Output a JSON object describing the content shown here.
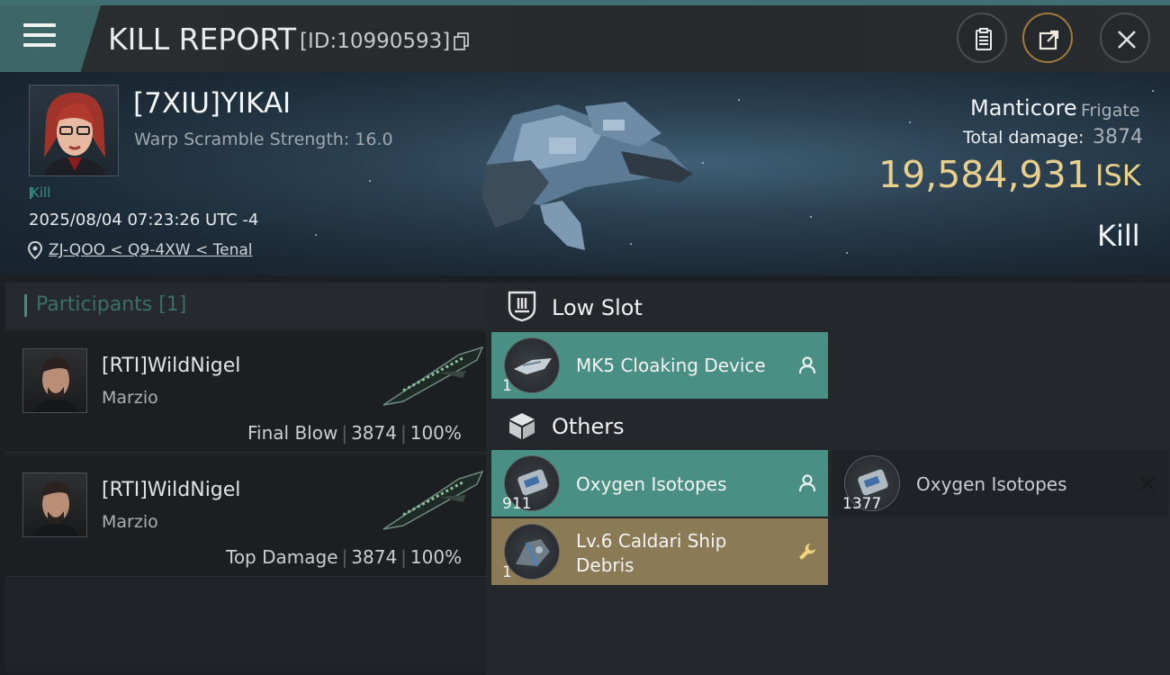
{
  "header": {
    "title": "KILL REPORT",
    "report_id": "[ID:10990593]"
  },
  "victim": {
    "name": "[7XIU]YIKAI",
    "warp_scramble": "Warp Scramble Strength: 16.0",
    "tag": "Kill",
    "timestamp": "2025/08/04 07:23:26 UTC -4",
    "location": "ZJ-QOO < Q9-4XW < Tenal"
  },
  "ship": {
    "name": "Manticore",
    "class": "Frigate",
    "total_damage_label": "Total damage:",
    "total_damage_value": "3874",
    "isk_value": "19,584,931",
    "isk_label": "ISK",
    "result": "Kill"
  },
  "participants": {
    "header": "Participants [1]",
    "rows": [
      {
        "name": "[RTI]WildNigel",
        "corp": "Marzio",
        "role": "Final Blow",
        "damage": "3874",
        "percent": "100%"
      },
      {
        "name": "[RTI]WildNigel",
        "corp": "Marzio",
        "role": "Top Damage",
        "damage": "3874",
        "percent": "100%"
      }
    ]
  },
  "sections": {
    "low_slot": {
      "title": "Low Slot",
      "items": [
        {
          "name": "MK5 Cloaking Device",
          "qty": "1",
          "status": "dropped"
        }
      ]
    },
    "others": {
      "title": "Others",
      "items": [
        {
          "name": "Oxygen Isotopes",
          "qty": "911",
          "status": "dropped"
        },
        {
          "name": "Oxygen Isotopes",
          "qty": "1377",
          "status": "destroyed"
        },
        {
          "name_line1": "Lv.6 Caldari Ship",
          "name_line2": "Debris",
          "qty": "1",
          "status": "salvage"
        }
      ]
    }
  },
  "colors": {
    "accent_teal": "#4a8f83",
    "isk_gold": "#e9cf8c",
    "salvage_gold": "#8a7a55"
  },
  "icons": {
    "menu": "hamburger-icon",
    "copy": "copy-icon",
    "clipboard": "clipboard-icon",
    "share": "share-icon",
    "close": "close-icon",
    "location": "location-pin-icon",
    "low_slot": "low-slot-icon",
    "others": "cube-icon",
    "dropped": "person-icon",
    "salvage": "wrench-icon",
    "destroyed": "x-icon"
  }
}
